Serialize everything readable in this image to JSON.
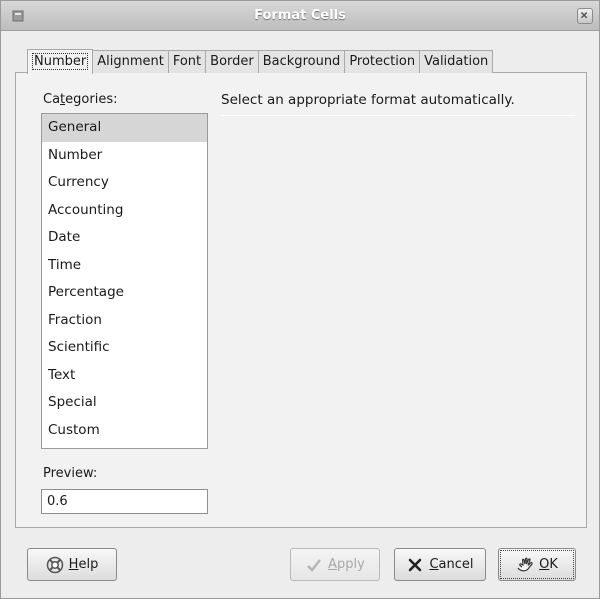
{
  "window": {
    "title": "Format Cells"
  },
  "tabs": [
    {
      "label": "Number",
      "active": true
    },
    {
      "label": "Alignment",
      "active": false
    },
    {
      "label": "Font",
      "active": false
    },
    {
      "label": "Border",
      "active": false
    },
    {
      "label": "Background",
      "active": false
    },
    {
      "label": "Protection",
      "active": false
    },
    {
      "label": "Validation",
      "active": false
    }
  ],
  "categories": {
    "label_pre": "Ca",
    "label_mnemonic": "t",
    "label_post": "egories:",
    "selected": "General",
    "items": [
      "General",
      "Number",
      "Currency",
      "Accounting",
      "Date",
      "Time",
      "Percentage",
      "Fraction",
      "Scientific",
      "Text",
      "Special",
      "Custom"
    ]
  },
  "description": "Select an appropriate format automatically.",
  "preview": {
    "label": "Preview:",
    "value": "0.6"
  },
  "buttons": {
    "help_mnemonic": "H",
    "help_rest": "elp",
    "apply_mnemonic": "A",
    "apply_rest": "pply",
    "cancel_mnemonic": "C",
    "cancel_rest": "ancel",
    "ok_mnemonic": "O",
    "ok_rest": "K"
  },
  "icons": {
    "window_menu": "window-menu-icon",
    "close": "close-icon",
    "help": "lifebuoy-icon",
    "apply": "checkmark-icon",
    "cancel": "cancel-x-icon",
    "ok": "ok-hand-icon"
  }
}
